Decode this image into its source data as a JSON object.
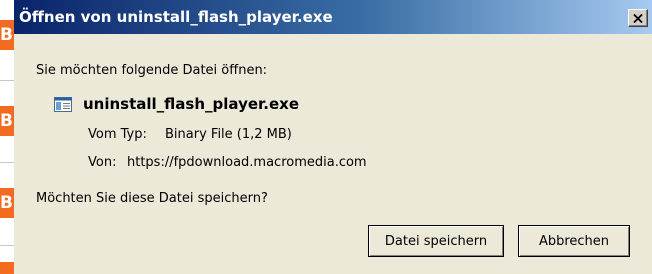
{
  "background": {
    "badge_letters": [
      "B",
      "B",
      "B"
    ]
  },
  "dialog": {
    "title": "Öffnen von uninstall_flash_player.exe",
    "prompt": "Sie möchten folgende Datei öffnen:",
    "file": {
      "name": "uninstall_flash_player.exe",
      "icon": "application-file-icon",
      "type_label": "Vom Typ:",
      "type_value": "Binary File (1,2 MB)",
      "source_label": "Von:",
      "source_value": "https://fpdownload.macromedia.com"
    },
    "question": "Möchten Sie diese Datei speichern?",
    "buttons": {
      "save": "Datei speichern",
      "cancel": "Abbrechen"
    },
    "colors": {
      "titlebar_start": "#0a246a",
      "titlebar_end": "#a6caf0",
      "badge": "#f26b21"
    }
  }
}
